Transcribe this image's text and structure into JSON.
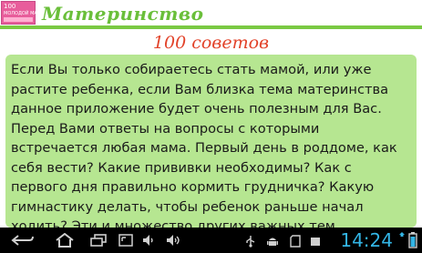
{
  "app": {
    "logo": {
      "line1": "100",
      "line2": "МОЛОДОЙ МАМЕ"
    },
    "title": "Материнство"
  },
  "subtitle": "100 советов",
  "content": {
    "lines": [
      "Если Вы только собираетесь стать мамой, или уже",
      "растите ребенка, если Вам близка тема материнства",
      "данное приложение будет очень полезным для Вас.",
      "Перед Вами ответы на вопросы с которыми",
      "встречается любая мама. Первый день в роддоме, как",
      "себя вести? Какие прививки необходимы? Как с",
      "первого дня правильно кормить грудничка? Какую",
      "гимнастику делать, чтобы ребенок раньше начал",
      "ходить? Эти и множество других важных тем"
    ]
  },
  "system_bar": {
    "time": "14:24",
    "icons": [
      "back-icon",
      "home-icon",
      "recent-apps-icon",
      "screenshot-icon",
      "volume-down-icon",
      "volume-up-icon",
      "usb-icon",
      "android-debug-icon",
      "sd-card-icon",
      "battery-icon"
    ],
    "accent_color": "#33b5e5"
  },
  "colors": {
    "accent_green": "#7ac943",
    "title_green": "#6abf3a",
    "subtitle_red": "#e2432a",
    "card_bg": "#b6e691",
    "logo_pink": "#e85d9b"
  }
}
